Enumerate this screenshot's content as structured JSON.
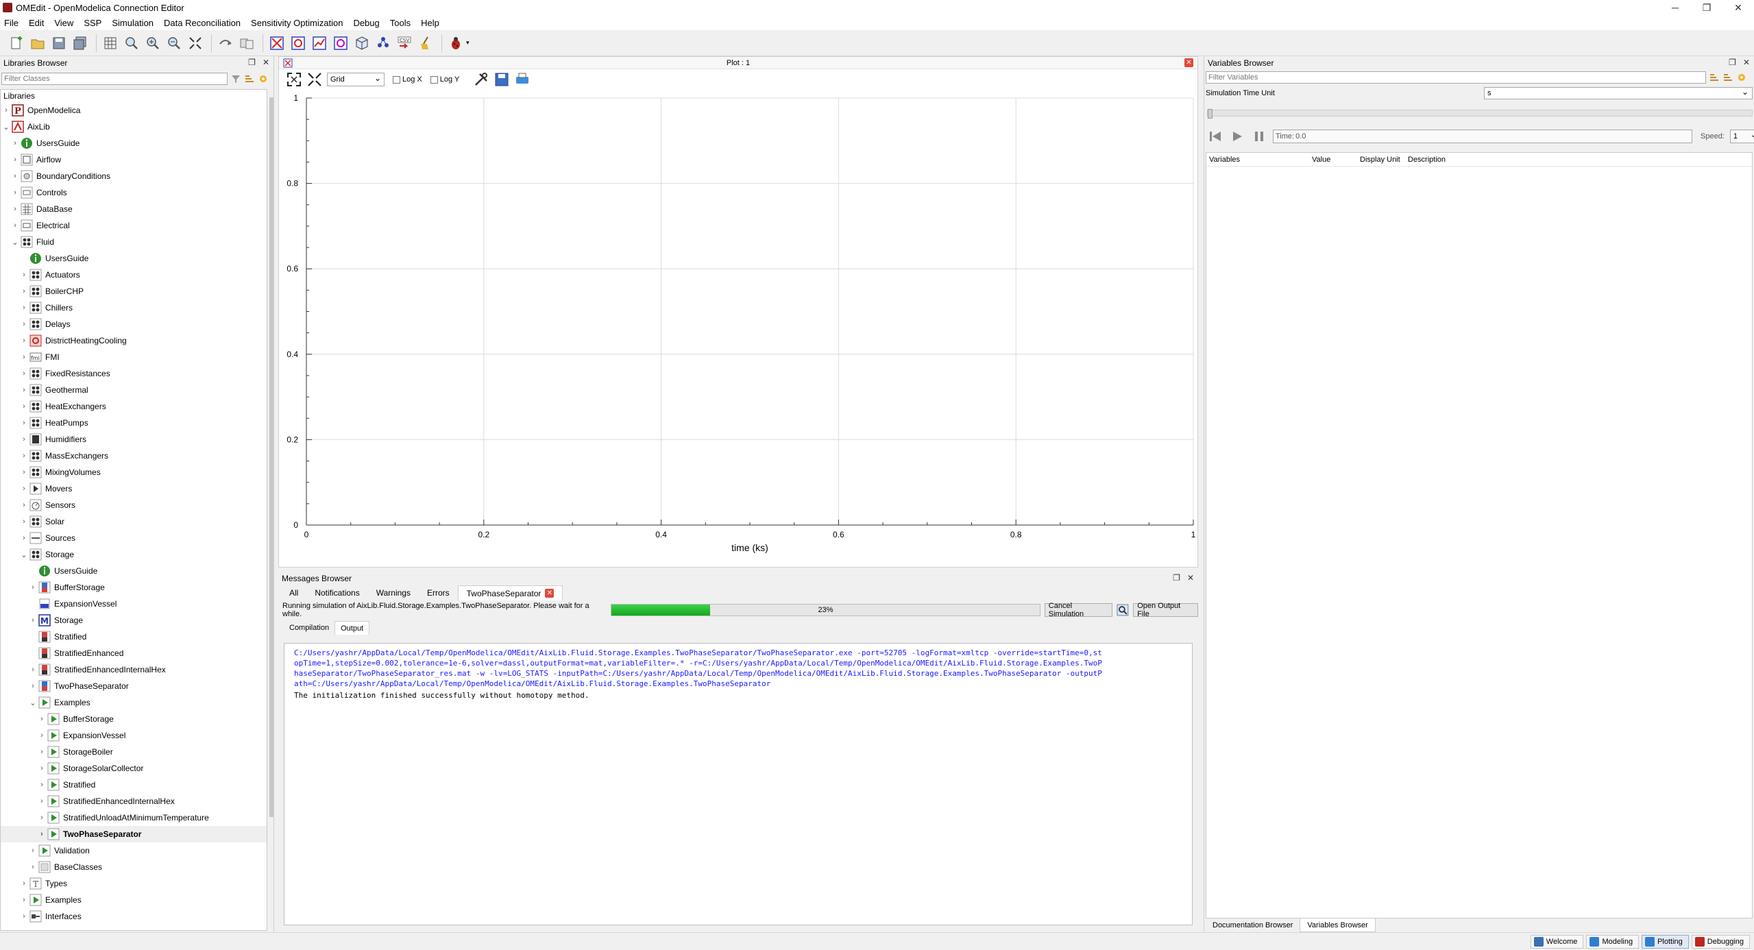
{
  "window": {
    "title": "OMEdit - OpenModelica Connection Editor"
  },
  "menu": [
    "File",
    "Edit",
    "View",
    "SSP",
    "Simulation",
    "Data Reconciliation",
    "Sensitivity Optimization",
    "Debug",
    "Tools",
    "Help"
  ],
  "toolbar": {
    "icons": [
      "new-file-icon",
      "open-icon",
      "save-icon",
      "save-all-icon",
      "grid-icon",
      "zoom-reset-icon",
      "zoom-in-icon",
      "zoom-out-icon",
      "fit-icon",
      "connect-icon",
      "transition-icon",
      "check-icon",
      "simulate-icon",
      "plot-icon",
      "parametric-plot-icon",
      "array-plot-icon",
      "model-3d-icon",
      "diagram-icon",
      "csv-export-icon",
      "clean-icon",
      "debug-icon"
    ]
  },
  "libraries": {
    "header": "Libraries Browser",
    "filter_placeholder": "Filter Classes",
    "root_label": "Libraries",
    "items": [
      {
        "label": "OpenModelica",
        "depth": 0,
        "arrow": ">",
        "icon": "package-p",
        "selected": false
      },
      {
        "label": "AixLib",
        "depth": 0,
        "arrow": "v",
        "icon": "aixlib",
        "selected": false
      },
      {
        "label": "UsersGuide",
        "depth": 1,
        "arrow": ">",
        "icon": "info",
        "selected": false
      },
      {
        "label": "Airflow",
        "depth": 1,
        "arrow": ">",
        "icon": "airflow",
        "selected": false
      },
      {
        "label": "BoundaryConditions",
        "depth": 1,
        "arrow": ">",
        "icon": "boundary",
        "selected": false
      },
      {
        "label": "Controls",
        "depth": 1,
        "arrow": ">",
        "icon": "controls",
        "selected": false
      },
      {
        "label": "DataBase",
        "depth": 1,
        "arrow": ">",
        "icon": "database",
        "selected": false
      },
      {
        "label": "Electrical",
        "depth": 1,
        "arrow": ">",
        "icon": "electrical",
        "selected": false
      },
      {
        "label": "Fluid",
        "depth": 1,
        "arrow": "v",
        "icon": "fluid",
        "selected": false
      },
      {
        "label": "UsersGuide",
        "depth": 2,
        "arrow": "",
        "icon": "info",
        "selected": false
      },
      {
        "label": "Actuators",
        "depth": 2,
        "arrow": ">",
        "icon": "fluid",
        "selected": false
      },
      {
        "label": "BoilerCHP",
        "depth": 2,
        "arrow": ">",
        "icon": "fluid",
        "selected": false
      },
      {
        "label": "Chillers",
        "depth": 2,
        "arrow": ">",
        "icon": "fluid",
        "selected": false
      },
      {
        "label": "Delays",
        "depth": 2,
        "arrow": ">",
        "icon": "fluid",
        "selected": false
      },
      {
        "label": "DistrictHeatingCooling",
        "depth": 2,
        "arrow": ">",
        "icon": "district",
        "selected": false
      },
      {
        "label": "FMI",
        "depth": 2,
        "arrow": ">",
        "icon": "fmi",
        "selected": false
      },
      {
        "label": "FixedResistances",
        "depth": 2,
        "arrow": ">",
        "icon": "fluid",
        "selected": false
      },
      {
        "label": "Geothermal",
        "depth": 2,
        "arrow": ">",
        "icon": "fluid",
        "selected": false
      },
      {
        "label": "HeatExchangers",
        "depth": 2,
        "arrow": ">",
        "icon": "fluid",
        "selected": false
      },
      {
        "label": "HeatPumps",
        "depth": 2,
        "arrow": ">",
        "icon": "fluid",
        "selected": false
      },
      {
        "label": "Humidifiers",
        "depth": 2,
        "arrow": ">",
        "icon": "humidifier",
        "selected": false
      },
      {
        "label": "MassExchangers",
        "depth": 2,
        "arrow": ">",
        "icon": "fluid",
        "selected": false
      },
      {
        "label": "MixingVolumes",
        "depth": 2,
        "arrow": ">",
        "icon": "fluid",
        "selected": false
      },
      {
        "label": "Movers",
        "depth": 2,
        "arrow": ">",
        "icon": "mover",
        "selected": false
      },
      {
        "label": "Sensors",
        "depth": 2,
        "arrow": ">",
        "icon": "sensor",
        "selected": false
      },
      {
        "label": "Solar",
        "depth": 2,
        "arrow": ">",
        "icon": "fluid",
        "selected": false
      },
      {
        "label": "Sources",
        "depth": 2,
        "arrow": ">",
        "icon": "source",
        "selected": false
      },
      {
        "label": "Storage",
        "depth": 2,
        "arrow": "v",
        "icon": "fluid",
        "selected": false
      },
      {
        "label": "UsersGuide",
        "depth": 3,
        "arrow": "",
        "icon": "info",
        "selected": false
      },
      {
        "label": "BufferStorage",
        "depth": 3,
        "arrow": ">",
        "icon": "buffer",
        "selected": false
      },
      {
        "label": "ExpansionVessel",
        "depth": 3,
        "arrow": "",
        "icon": "vessel",
        "selected": false
      },
      {
        "label": "Storage",
        "depth": 3,
        "arrow": ">",
        "icon": "model-m",
        "selected": false
      },
      {
        "label": "Stratified",
        "depth": 3,
        "arrow": "",
        "icon": "stratified",
        "selected": false
      },
      {
        "label": "StratifiedEnhanced",
        "depth": 3,
        "arrow": "",
        "icon": "stratified",
        "selected": false
      },
      {
        "label": "StratifiedEnhancedInternalHex",
        "depth": 3,
        "arrow": ">",
        "icon": "stratified",
        "selected": false
      },
      {
        "label": "TwoPhaseSeparator",
        "depth": 3,
        "arrow": ">",
        "icon": "buffer",
        "selected": false
      },
      {
        "label": "Examples",
        "depth": 3,
        "arrow": "v",
        "icon": "examples",
        "selected": false
      },
      {
        "label": "BufferStorage",
        "depth": 4,
        "arrow": ">",
        "icon": "play",
        "selected": false
      },
      {
        "label": "ExpansionVessel",
        "depth": 4,
        "arrow": ">",
        "icon": "play",
        "selected": false
      },
      {
        "label": "StorageBoiler",
        "depth": 4,
        "arrow": ">",
        "icon": "play",
        "selected": false
      },
      {
        "label": "StorageSolarCollector",
        "depth": 4,
        "arrow": ">",
        "icon": "play",
        "selected": false
      },
      {
        "label": "Stratified",
        "depth": 4,
        "arrow": ">",
        "icon": "play",
        "selected": false
      },
      {
        "label": "StratifiedEnhancedInternalHex",
        "depth": 4,
        "arrow": ">",
        "icon": "play",
        "selected": false
      },
      {
        "label": "StratifiedUnloadAtMinimumTemperature",
        "depth": 4,
        "arrow": ">",
        "icon": "play",
        "selected": false
      },
      {
        "label": "TwoPhaseSeparator",
        "depth": 4,
        "arrow": ">",
        "icon": "play",
        "selected": true
      },
      {
        "label": "Validation",
        "depth": 3,
        "arrow": ">",
        "icon": "examples",
        "selected": false
      },
      {
        "label": "BaseClasses",
        "depth": 3,
        "arrow": ">",
        "icon": "baseclasses",
        "selected": false
      },
      {
        "label": "Types",
        "depth": 2,
        "arrow": ">",
        "icon": "types",
        "selected": false
      },
      {
        "label": "Examples",
        "depth": 2,
        "arrow": ">",
        "icon": "examples",
        "selected": false
      },
      {
        "label": "Interfaces",
        "depth": 2,
        "arrow": ">",
        "icon": "interfaces",
        "selected": false
      }
    ]
  },
  "plot": {
    "title": "Plot : 1",
    "grid_option": "Grid",
    "log_x_label": "Log X",
    "log_y_label": "Log Y",
    "log_x": false,
    "log_y": false
  },
  "chart_data": {
    "type": "line",
    "series": [],
    "xlabel": "time (ks)",
    "ylabel": "",
    "xlim": [
      0,
      1
    ],
    "ylim": [
      0,
      1
    ],
    "x_ticks": [
      "0",
      "0.2",
      "0.4",
      "0.6",
      "0.8",
      "1"
    ],
    "y_ticks": [
      "0",
      "0.2",
      "0.4",
      "0.6",
      "0.8",
      "1"
    ],
    "grid": true
  },
  "messages": {
    "header": "Messages Browser",
    "tabs": [
      "All",
      "Notifications",
      "Warnings",
      "Errors",
      "TwoPhaseSeparator"
    ],
    "active_tab": "TwoPhaseSeparator",
    "status_text": "Running simulation of AixLib.Fluid.Storage.Examples.TwoPhaseSeparator. Please wait for a while.",
    "progress_percent": 23,
    "progress_label": "23%",
    "cancel_label": "Cancel Simulation",
    "open_output_label": "Open Output File",
    "sub_tabs": [
      "Compilation",
      "Output"
    ],
    "active_sub_tab": "Output",
    "command_text": "C:/Users/yashr/AppData/Local/Temp/OpenModelica/OMEdit/AixLib.Fluid.Storage.Examples.TwoPhaseSeparator/TwoPhaseSeparator.exe -port=52705 -logFormat=xmltcp -override=startTime=0,stopTime=1,stepSize=0.002,tolerance=1e-6,solver=dassl,outputFormat=mat,variableFilter=.* -r=C:/Users/yashr/AppData/Local/Temp/OpenModelica/OMEdit/AixLib.Fluid.Storage.Examples.TwoPhaseSeparator/TwoPhaseSeparator_res.mat -w -lv=LOG_STATS -inputPath=C:/Users/yashr/AppData/Local/Temp/OpenModelica/OMEdit/AixLib.Fluid.Storage.Examples.TwoPhaseSeparator -outputPath=C:/Users/yashr/AppData/Local/Temp/OpenModelica/OMEdit/AixLib.Fluid.Storage.Examples.TwoPhaseSeparator",
    "init_text": "The initialization finished successfully without homotopy method."
  },
  "variables": {
    "header": "Variables Browser",
    "filter_placeholder": "Filter Variables",
    "time_unit_label": "Simulation Time Unit",
    "time_unit_value": "s",
    "time_label": "Time:",
    "time_value": "0.0",
    "speed_label": "Speed:",
    "speed_value": "1",
    "columns": [
      "Variables",
      "Value",
      "Display Unit",
      "Description"
    ],
    "bottom_tabs": [
      "Documentation Browser",
      "Variables Browser"
    ],
    "active_bottom_tab": "Variables Browser"
  },
  "perspectives": [
    {
      "label": "Welcome",
      "color": "#3a6fb0"
    },
    {
      "label": "Modeling",
      "color": "#2f7fd0"
    },
    {
      "label": "Plotting",
      "color": "#2f7fd0"
    },
    {
      "label": "Debugging",
      "color": "#c0261e"
    }
  ],
  "active_perspective": "Plotting",
  "colors": {
    "progress": "#1aba26",
    "command_text": "#1a1aff",
    "close": "#e04a3a"
  }
}
